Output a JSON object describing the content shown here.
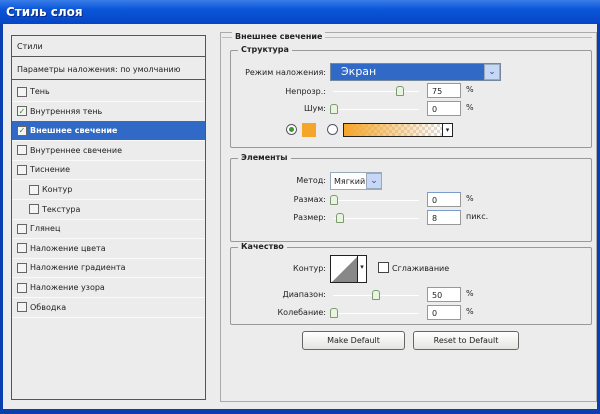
{
  "window": {
    "title": "Стиль слоя"
  },
  "sidebar": {
    "header": "Стили",
    "blending": "Параметры наложения: по умолчанию",
    "items": [
      {
        "label": "Тень",
        "checked": false
      },
      {
        "label": "Внутренняя тень",
        "checked": true
      },
      {
        "label": "Внешнее свечение",
        "checked": true,
        "selected": true
      },
      {
        "label": "Внутреннее свечение",
        "checked": false
      },
      {
        "label": "Тиснение",
        "checked": false
      },
      {
        "label": "Контур",
        "checked": false,
        "indent": true
      },
      {
        "label": "Текстура",
        "checked": false,
        "indent": true
      },
      {
        "label": "Глянец",
        "checked": false
      },
      {
        "label": "Наложение цвета",
        "checked": false
      },
      {
        "label": "Наложение градиента",
        "checked": false
      },
      {
        "label": "Наложение узора",
        "checked": false
      },
      {
        "label": "Обводка",
        "checked": false
      }
    ]
  },
  "panel": {
    "title": "Внешнее свечение",
    "structure": {
      "legend": "Структура",
      "blend_label": "Режим наложения:",
      "blend_value": "Экран",
      "opacity_label": "Непрозр.:",
      "opacity": "75",
      "opacity_unit": "%",
      "noise_label": "Шум:",
      "noise": "0",
      "noise_unit": "%",
      "color": "#f5a52a"
    },
    "elements": {
      "legend": "Элементы",
      "method_label": "Метод:",
      "method_value": "Мягкий",
      "spread_label": "Размах:",
      "spread": "0",
      "spread_unit": "%",
      "size_label": "Размер:",
      "size": "8",
      "size_unit": "пикс."
    },
    "quality": {
      "legend": "Качество",
      "contour_label": "Контур:",
      "antialias_label": "Сглаживание",
      "range_label": "Диапазон:",
      "range": "50",
      "range_unit": "%",
      "jitter_label": "Колебание:",
      "jitter": "0",
      "jitter_unit": "%"
    },
    "buttons": {
      "make_default": "Make Default",
      "reset_default": "Reset to Default"
    }
  }
}
